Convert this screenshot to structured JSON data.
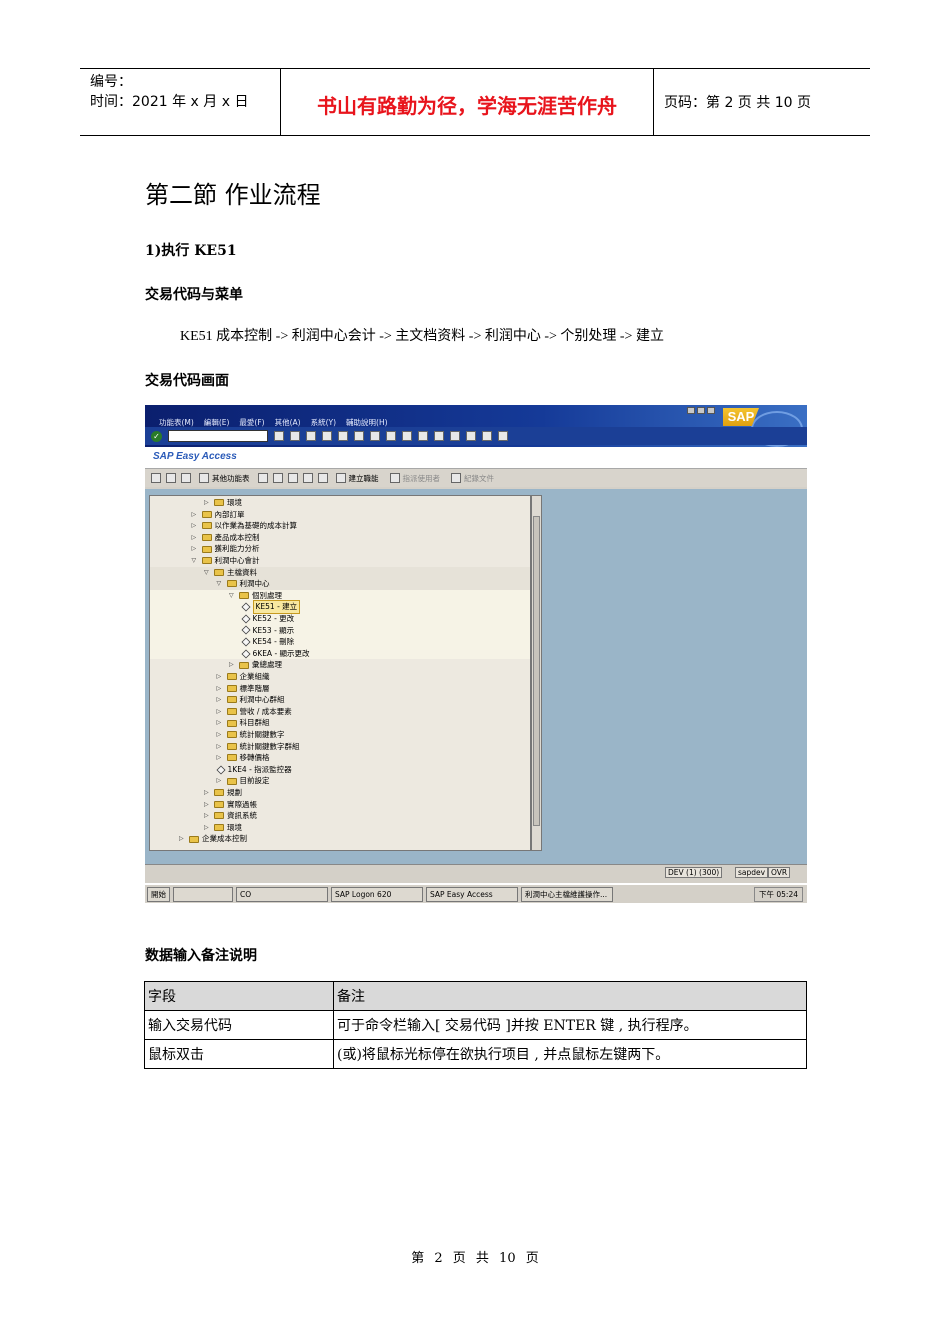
{
  "header": {
    "number_label": "编号：",
    "time_label": "时间：2021 年 x 月 x 日",
    "motto": "书山有路勤为径，学海无涯苦作舟",
    "page_label": "页码：第 2 页 共 10 页"
  },
  "section_title": "第二節 作业流程",
  "step1": "1)执行 KE51",
  "menu_heading": "交易代码与菜单",
  "menu_path": "KE51 成本控制 -> 利润中心会计 -> 主文档资料 -> 利润中心 -> 个别处理 -> 建立",
  "screen_heading": "交易代码画面",
  "sap": {
    "menu": [
      "功能表(M)",
      "編輯(E)",
      "最愛(F)",
      "其他(A)",
      "系統(Y)",
      "輔助說明(H)"
    ],
    "logo": "SAP",
    "app_title": "SAP Easy Access",
    "toolbar": {
      "other_menu": "其他功能表",
      "create_role": "建立職能",
      "assign_users": "指派使用者",
      "documentation": "紀錄文件"
    },
    "tree": [
      {
        "label": "環境",
        "level": 4,
        "type": "folder",
        "open": false
      },
      {
        "label": "內部訂單",
        "level": 3,
        "type": "folder",
        "open": false
      },
      {
        "label": "以作業為基礎的成本計算",
        "level": 3,
        "type": "folder",
        "open": false
      },
      {
        "label": "產品成本控制",
        "level": 3,
        "type": "folder",
        "open": false
      },
      {
        "label": "獲利能力分析",
        "level": 3,
        "type": "folder",
        "open": false
      },
      {
        "label": "利潤中心會計",
        "level": 3,
        "type": "folder",
        "open": true
      },
      {
        "label": "主檔資料",
        "level": 4,
        "type": "folder",
        "open": true
      },
      {
        "label": "利潤中心",
        "level": 5,
        "type": "folder",
        "open": true
      },
      {
        "label": "個別處理",
        "level": 6,
        "type": "folder",
        "open": true
      },
      {
        "label": "KE51 - 建立",
        "level": 7,
        "type": "tx",
        "selected": true
      },
      {
        "label": "KE52 - 更改",
        "level": 7,
        "type": "tx"
      },
      {
        "label": "KE53 - 顯示",
        "level": 7,
        "type": "tx"
      },
      {
        "label": "KE54 - 刪除",
        "level": 7,
        "type": "tx"
      },
      {
        "label": "6KEA - 顯示更改",
        "level": 7,
        "type": "tx"
      },
      {
        "label": "彙總處理",
        "level": 6,
        "type": "folder",
        "open": false
      },
      {
        "label": "企業組織",
        "level": 5,
        "type": "folder",
        "open": false
      },
      {
        "label": "標準階層",
        "level": 5,
        "type": "folder",
        "open": false
      },
      {
        "label": "利潤中心群組",
        "level": 5,
        "type": "folder",
        "open": false
      },
      {
        "label": "營收 / 成本要素",
        "level": 5,
        "type": "folder",
        "open": false
      },
      {
        "label": "科目群組",
        "level": 5,
        "type": "folder",
        "open": false
      },
      {
        "label": "統計關鍵數字",
        "level": 5,
        "type": "folder",
        "open": false
      },
      {
        "label": "統計關鍵數字群組",
        "level": 5,
        "type": "folder",
        "open": false
      },
      {
        "label": "移轉價格",
        "level": 5,
        "type": "folder",
        "open": false
      },
      {
        "label": "1KE4 - 指派監控器",
        "level": 5,
        "type": "tx"
      },
      {
        "label": "目前設定",
        "level": 5,
        "type": "folder",
        "open": false
      },
      {
        "label": "規劃",
        "level": 4,
        "type": "folder",
        "open": false
      },
      {
        "label": "實際過帳",
        "level": 4,
        "type": "folder",
        "open": false
      },
      {
        "label": "資訊系統",
        "level": 4,
        "type": "folder",
        "open": false
      },
      {
        "label": "環境",
        "level": 4,
        "type": "folder",
        "open": false
      },
      {
        "label": "企業成本控制",
        "level": 2,
        "type": "folder",
        "open": false
      }
    ],
    "status": {
      "system": "DEV (1) (300)",
      "server": "sapdev",
      "mode": "OVR"
    },
    "taskbar": {
      "start": "開始",
      "items": [
        "CO",
        "SAP Logon 620",
        "SAP Easy Access",
        "利潤中心主檔維護操作..."
      ],
      "clock": "下午 05:24"
    }
  },
  "table_heading": "数据输入备注说明",
  "table": {
    "headers": [
      "字段",
      "备注"
    ],
    "rows": [
      [
        "输入交易代码",
        "可于命令栏输入[ 交易代码 ]并按 ENTER 键 , 执行程序。"
      ],
      [
        "鼠标双击",
        "(或)将鼠标光标停在欲执行项目 , 并点鼠标左键两下。"
      ]
    ]
  },
  "footer": "第 2 页 共 10 页"
}
